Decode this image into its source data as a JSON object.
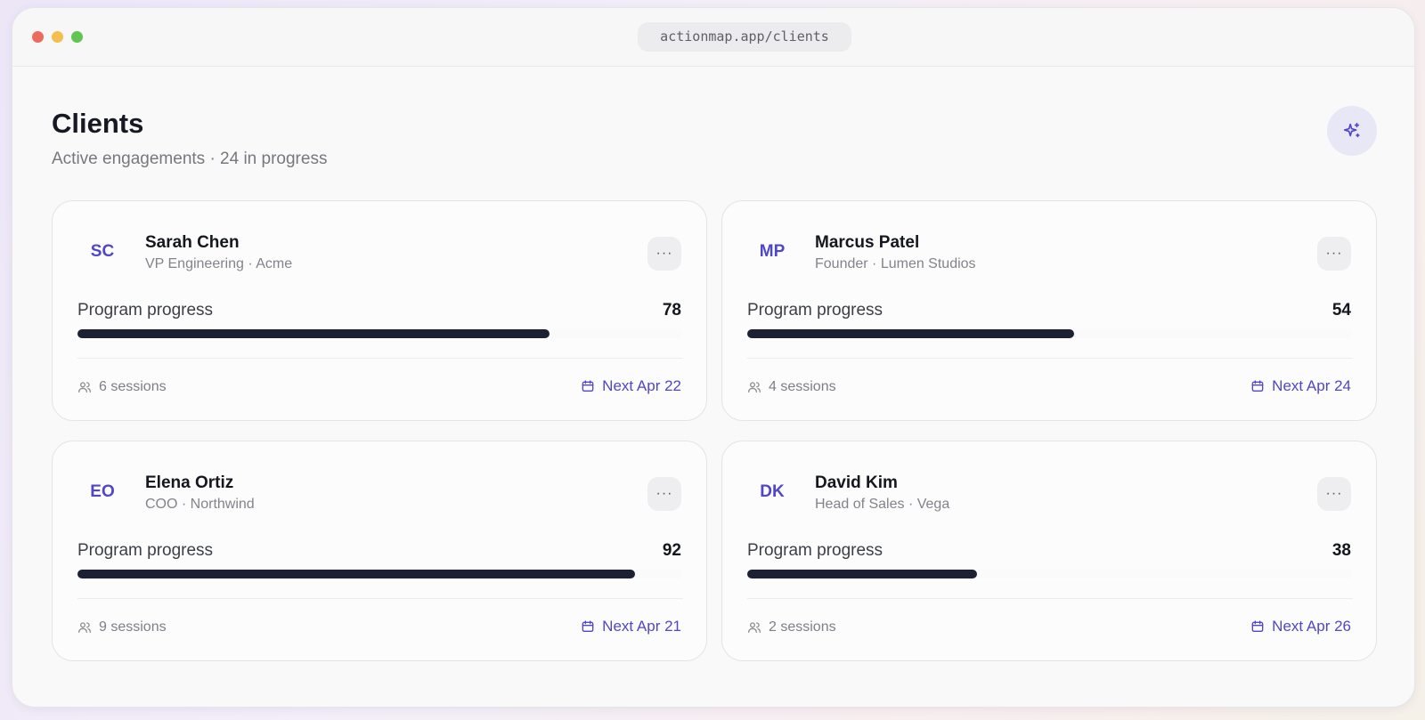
{
  "browser": {
    "url": "actionmap.app/clients"
  },
  "header": {
    "title": "Clients",
    "subtitle": "Active engagements · 24 in progress",
    "ai_icon": "sparkles-icon"
  },
  "colors": {
    "accent": "#4f46c8",
    "progress_fill": "#1c2033"
  },
  "clients": [
    {
      "initials": "SC",
      "name": "Sarah Chen",
      "role": "VP Engineering · Acme",
      "progress_label": "Program progress",
      "progress": 78,
      "progress_text": "78",
      "sessions": "6 sessions",
      "next": "Next Apr 22"
    },
    {
      "initials": "MP",
      "name": "Marcus Patel",
      "role": "Founder · Lumen Studios",
      "progress_label": "Program progress",
      "progress": 54,
      "progress_text": "54",
      "sessions": "4 sessions",
      "next": "Next Apr 24"
    },
    {
      "initials": "EO",
      "name": "Elena Ortiz",
      "role": "COO · Northwind",
      "progress_label": "Program progress",
      "progress": 92,
      "progress_text": "92",
      "sessions": "9 sessions",
      "next": "Next Apr 21"
    },
    {
      "initials": "DK",
      "name": "David Kim",
      "role": "Head of Sales · Vega",
      "progress_label": "Program progress",
      "progress": 38,
      "progress_text": "38",
      "sessions": "2 sessions",
      "next": "Next Apr 26"
    }
  ],
  "icons": {
    "more": "more-horizontal-icon",
    "sessions": "users-icon",
    "next": "calendar-icon"
  },
  "more_glyph": "···"
}
